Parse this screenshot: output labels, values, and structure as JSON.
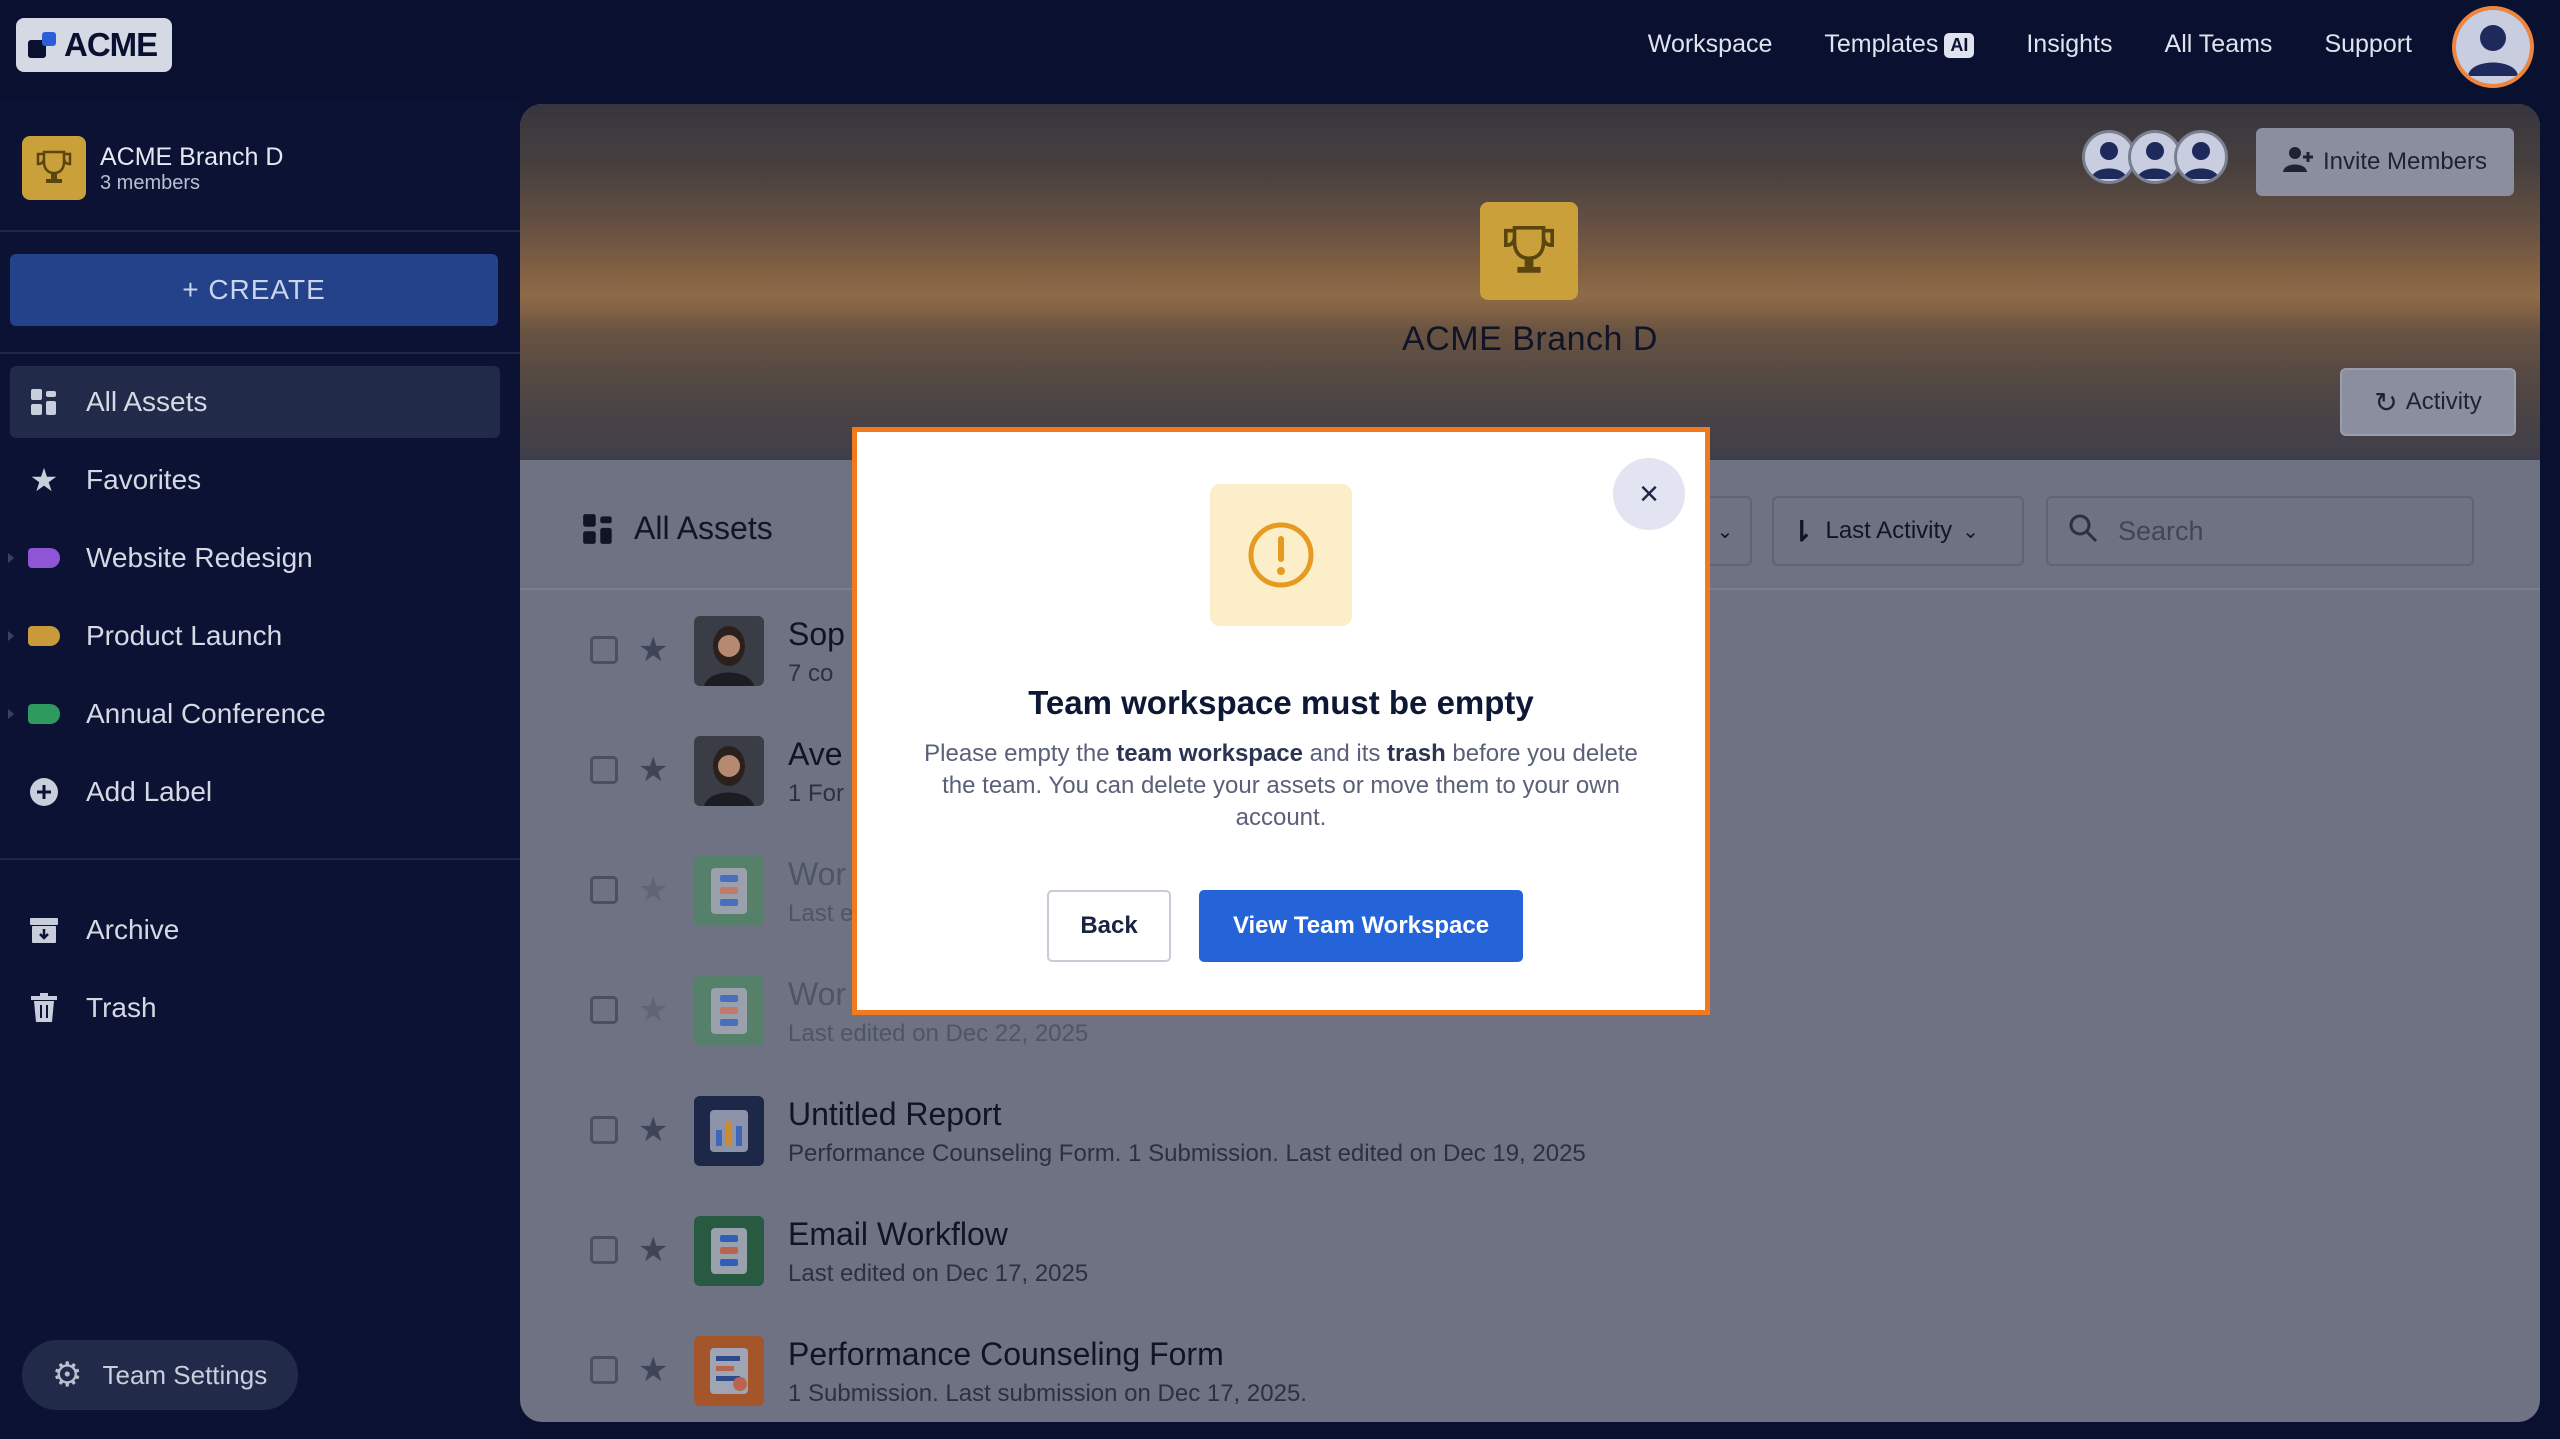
{
  "brand": {
    "logo_text": "ACME"
  },
  "topnav": {
    "items": [
      "Workspace",
      "Templates",
      "Insights",
      "All Teams",
      "Support"
    ],
    "ai_badge": "AI"
  },
  "sidebar": {
    "team_name": "ACME Branch D",
    "team_members": "3 members",
    "create_label": "+ CREATE",
    "items": [
      {
        "label": "All Assets",
        "icon": "grid-icon"
      },
      {
        "label": "Favorites",
        "icon": "star-icon"
      },
      {
        "label": "Website Redesign",
        "icon": "label-icon",
        "color": "#8e55d6"
      },
      {
        "label": "Product Launch",
        "icon": "label-icon",
        "color": "#c99a3c"
      },
      {
        "label": "Annual Conference",
        "icon": "label-icon",
        "color": "#2f9a5e"
      },
      {
        "label": "Add Label",
        "icon": "plus-circle-icon"
      },
      {
        "label": "Archive",
        "icon": "archive-icon"
      },
      {
        "label": "Trash",
        "icon": "trash-icon"
      }
    ],
    "team_settings": "Team Settings"
  },
  "banner": {
    "title": "ACME Branch D",
    "invite_label": "Invite Members",
    "activity_label": "Activity"
  },
  "toolbar": {
    "title": "All Assets",
    "sort_label": "Last Activity",
    "search_placeholder": "Search"
  },
  "assets": [
    {
      "title": "Sop",
      "sub": "7 co"
    },
    {
      "title": "Ave",
      "sub": "1 For"
    },
    {
      "title": "Wor",
      "sub": "Last e"
    },
    {
      "title": "Wor",
      "sub": "Last edited on Dec 22, 2025"
    },
    {
      "title": "Untitled Report",
      "sub": "Performance Counseling Form. 1 Submission. Last edited on Dec 19, 2025"
    },
    {
      "title": "Email Workflow",
      "sub": "Last edited on Dec 17, 2025"
    },
    {
      "title": "Performance Counseling Form",
      "sub": "1 Submission.  Last submission on Dec 17, 2025."
    }
  ],
  "dialog": {
    "title": "Team workspace must be empty",
    "text_1": "Please empty the ",
    "bold_1": "team workspace",
    "text_2": " and its ",
    "bold_2": "trash",
    "text_3": " before you delete the team. You can delete your assets or move them to your own account.",
    "back_label": "Back",
    "primary_label": "View Team Workspace",
    "close_glyph": "×"
  },
  "colors": {
    "accent": "#2563d9",
    "dialog_border": "#f07a1d",
    "warning_bg": "#fbeec8",
    "warning_icon": "#e69a1f"
  }
}
